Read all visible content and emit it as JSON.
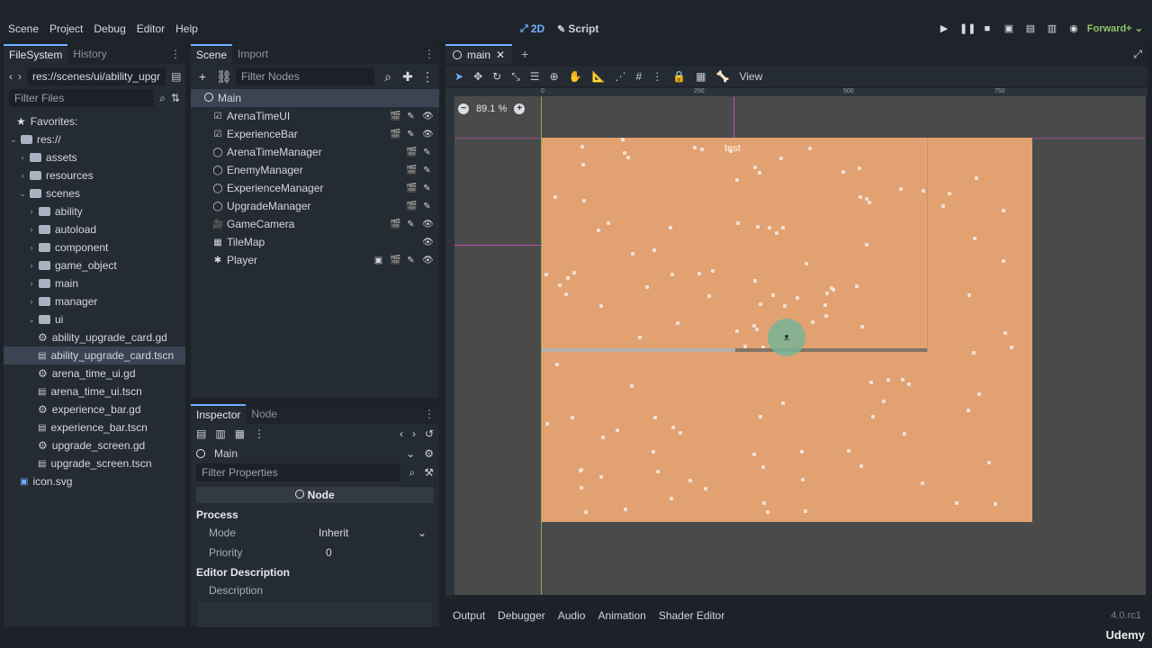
{
  "menu": [
    "Scene",
    "Project",
    "Debug",
    "Editor",
    "Help"
  ],
  "modes": {
    "two_d": "2D",
    "script": "Script"
  },
  "renderer": "Forward+",
  "filesystem": {
    "tabs": [
      "FileSystem",
      "History"
    ],
    "path": "res://scenes/ui/ability_upgr",
    "filter_placeholder": "Filter Files",
    "favorites": "Favorites:",
    "root": "res://",
    "items": [
      {
        "label": "assets",
        "type": "folder",
        "depth": 1
      },
      {
        "label": "resources",
        "type": "folder",
        "depth": 1
      },
      {
        "label": "scenes",
        "type": "folder",
        "depth": 1
      },
      {
        "label": "ability",
        "type": "folder",
        "depth": 2
      },
      {
        "label": "autoload",
        "type": "folder",
        "depth": 2
      },
      {
        "label": "component",
        "type": "folder",
        "depth": 2
      },
      {
        "label": "game_object",
        "type": "folder",
        "depth": 2
      },
      {
        "label": "main",
        "type": "folder",
        "depth": 2
      },
      {
        "label": "manager",
        "type": "folder",
        "depth": 2
      },
      {
        "label": "ui",
        "type": "folder",
        "depth": 2
      },
      {
        "label": "ability_upgrade_card.gd",
        "type": "script",
        "depth": 3
      },
      {
        "label": "ability_upgrade_card.tscn",
        "type": "scene",
        "depth": 3
      },
      {
        "label": "arena_time_ui.gd",
        "type": "script",
        "depth": 3
      },
      {
        "label": "arena_time_ui.tscn",
        "type": "scene",
        "depth": 3
      },
      {
        "label": "experience_bar.gd",
        "type": "script",
        "depth": 3
      },
      {
        "label": "experience_bar.tscn",
        "type": "scene",
        "depth": 3
      },
      {
        "label": "upgrade_screen.gd",
        "type": "script",
        "depth": 3
      },
      {
        "label": "upgrade_screen.tscn",
        "type": "scene",
        "depth": 3
      },
      {
        "label": "icon.svg",
        "type": "svg",
        "depth": 1
      }
    ]
  },
  "scene": {
    "tabs": [
      "Scene",
      "Import"
    ],
    "filter_placeholder": "Filter Nodes",
    "root": "Main",
    "nodes": [
      "ArenaTimeUI",
      "ExperienceBar",
      "ArenaTimeManager",
      "EnemyManager",
      "ExperienceManager",
      "UpgradeManager",
      "GameCamera",
      "TileMap",
      "Player"
    ]
  },
  "inspector": {
    "tabs": [
      "Inspector",
      "Node"
    ],
    "object": "Main",
    "filter_placeholder": "Filter Properties",
    "section": "Node",
    "process": "Process",
    "mode_label": "Mode",
    "mode_value": "Inherit",
    "priority_label": "Priority",
    "priority_value": "0",
    "editor_description": "Editor Description",
    "description_label": "Description"
  },
  "viewport": {
    "tab": "main",
    "view_menu": "View",
    "zoom": "89.1 %",
    "label_in_scene": "test",
    "ruler_ticks": [
      "0",
      "250",
      "500",
      "750"
    ]
  },
  "bottom_tabs": [
    "Output",
    "Debugger",
    "Audio",
    "Animation",
    "Shader Editor"
  ],
  "version": "4.0.rc1",
  "watermark": "Udemy"
}
